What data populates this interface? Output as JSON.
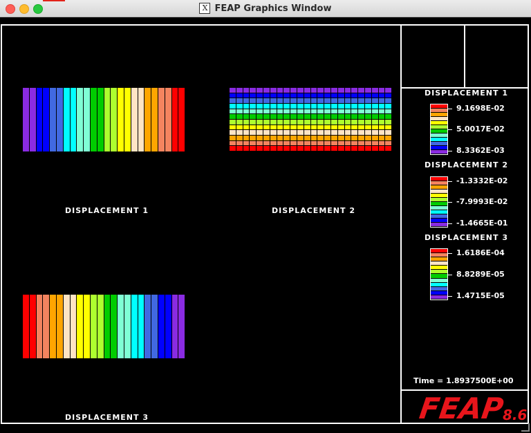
{
  "window": {
    "title": "FEAP Graphics Window",
    "x_icon": "X"
  },
  "panels": [
    {
      "caption": "DISPLACEMENT 1"
    },
    {
      "caption": "DISPLACEMENT 2"
    },
    {
      "caption": "DISPLACEMENT 3"
    }
  ],
  "legend": [
    {
      "title": "DISPLACEMENT 1",
      "values": [
        "9.1698E-02",
        "5.0017E-02",
        "8.3362E-03"
      ]
    },
    {
      "title": "DISPLACEMENT 2",
      "values": [
        "-1.3332E-02",
        "-7.9993E-02",
        "-1.4665E-01"
      ]
    },
    {
      "title": "DISPLACEMENT 3",
      "values": [
        "1.6186E-04",
        "8.8289E-05",
        "1.4715E-05"
      ]
    }
  ],
  "time_label": "Time = 1.8937500E+00",
  "logo": {
    "text": "FEAP",
    "version": "8.6"
  },
  "colors": {
    "scale": [
      "#ff0000",
      "#f4845f",
      "#ffa500",
      "#ffe4c4",
      "#ffff00",
      "#adff2f",
      "#00cc00",
      "#7fffd4",
      "#00ffff",
      "#4169e1",
      "#0000ff",
      "#8a2be2"
    ],
    "logo": "#e8151b",
    "background": "#000000"
  }
}
